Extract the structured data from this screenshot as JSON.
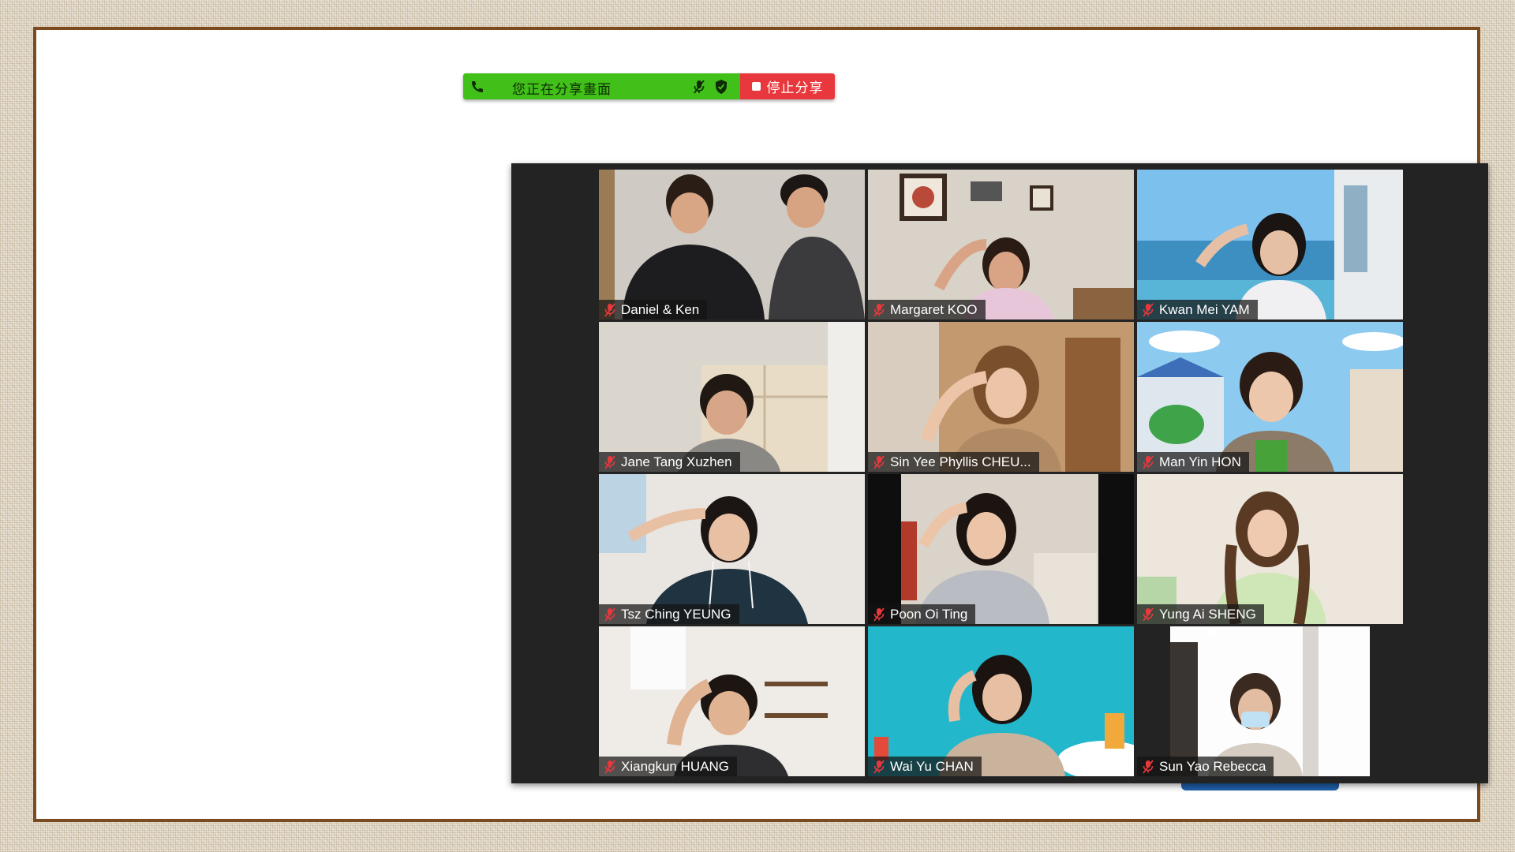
{
  "share_toolbar": {
    "status_text": "您正在分享畫面",
    "stop_label": "停止分享",
    "phone_icon": "phone-icon",
    "mic_icon": "mic-muted-icon",
    "shield_icon": "shield-check-icon",
    "green_color": "#40c018",
    "stop_color": "#e8383d"
  },
  "participants": [
    {
      "name": "Daniel & Ken",
      "muted": true
    },
    {
      "name": "Margaret KOO",
      "muted": true
    },
    {
      "name": "Kwan Mei YAM",
      "muted": true
    },
    {
      "name": "Jane Tang Xuzhen",
      "muted": true
    },
    {
      "name": "Sin Yee Phyllis CHEU...",
      "muted": true
    },
    {
      "name": "Man Yin HON",
      "muted": true
    },
    {
      "name": "Tsz Ching YEUNG",
      "muted": true
    },
    {
      "name": "Poon Oi Ting",
      "muted": true
    },
    {
      "name": "Yung Ai SHENG",
      "muted": true
    },
    {
      "name": "Xiangkun HUANG",
      "muted": true
    },
    {
      "name": "Wai Yu CHAN",
      "muted": true
    },
    {
      "name": "Sun Yao Rebecca",
      "muted": true
    }
  ],
  "colors": {
    "frame": "#7b4a1f",
    "window_bg": "#232323",
    "mute_red": "#e8383d"
  }
}
